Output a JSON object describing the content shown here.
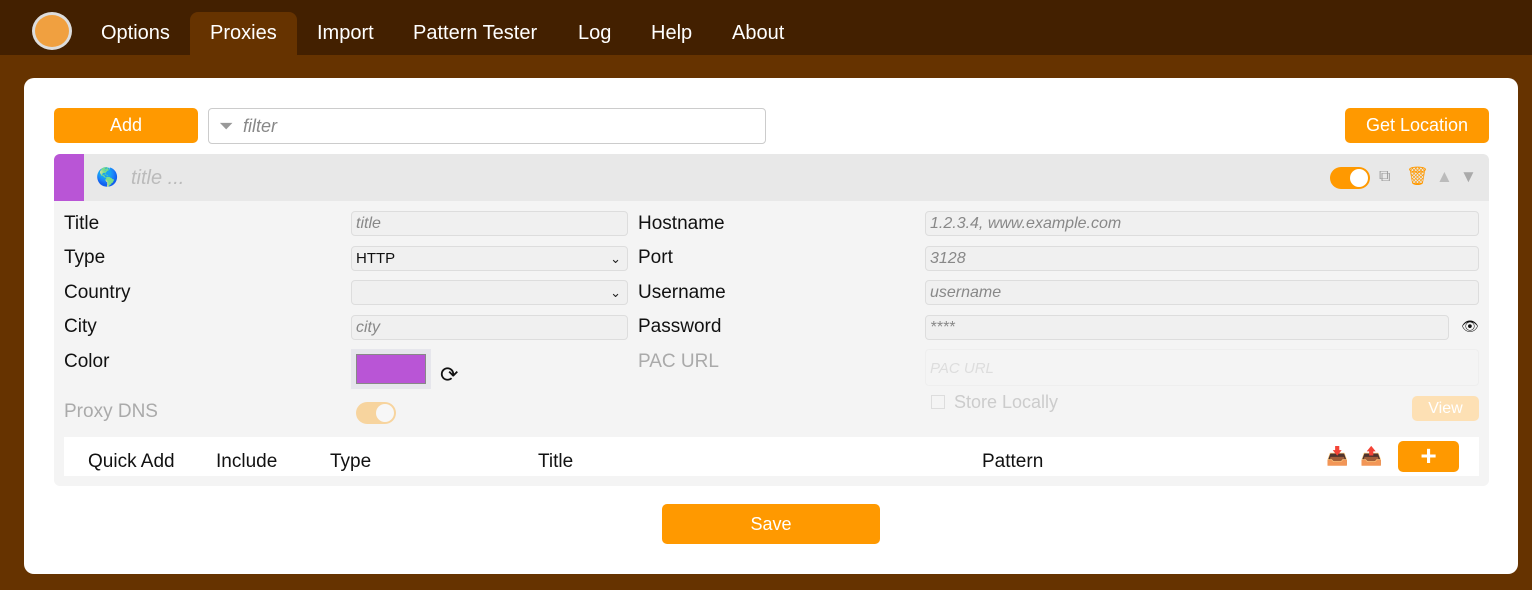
{
  "nav": {
    "tabs": [
      "Options",
      "Proxies",
      "Import",
      "Pattern Tester",
      "Log",
      "Help",
      "About"
    ],
    "active": "Proxies"
  },
  "toolbar": {
    "add": "Add",
    "filter_placeholder": "filter",
    "get_location": "Get Location"
  },
  "proxy": {
    "title_placeholder": "title ...",
    "color": "#b955d6",
    "enabled": true,
    "labels": {
      "title": "Title",
      "type": "Type",
      "country": "Country",
      "city": "City",
      "color": "Color",
      "proxy_dns": "Proxy DNS",
      "hostname": "Hostname",
      "port": "Port",
      "username": "Username",
      "password": "Password",
      "pac_url": "PAC URL",
      "store_locally": "Store Locally",
      "view": "View"
    },
    "placeholders": {
      "title": "title",
      "city": "city",
      "hostname": "1.2.3.4, www.example.com",
      "port": "3128",
      "username": "username",
      "password": "****",
      "pac_url": "PAC URL"
    },
    "type_value": "HTTP",
    "country_value": "",
    "proxy_dns": true,
    "store_locally": false
  },
  "patterns": {
    "headers": [
      "Quick Add",
      "Include",
      "Type",
      "Title",
      "Pattern"
    ],
    "add": "+"
  },
  "save": "Save",
  "colors": {
    "accent": "#ff9900",
    "nav_bg": "#432000",
    "page_bg": "#663300"
  }
}
